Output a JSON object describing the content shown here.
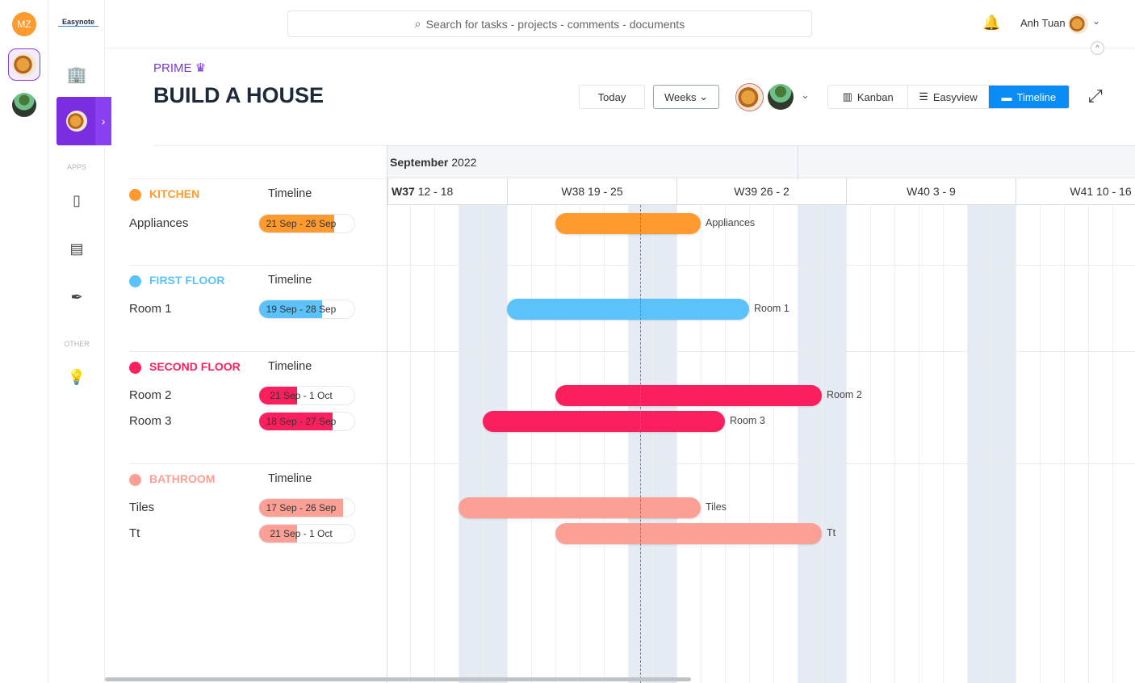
{
  "rail": {
    "user_initials": "MZ",
    "user_color": "#ff9a2e"
  },
  "sidebar": {
    "logo": "Easynote",
    "apps_label": "APPS",
    "other_label": "OTHER",
    "icons": [
      "building-icon",
      "book-icon",
      "document-icon",
      "pen-icon",
      "lightbulb-icon"
    ]
  },
  "search": {
    "placeholder": "Search for tasks - projects - comments - documents"
  },
  "user": {
    "name": "Anh Tuan"
  },
  "project": {
    "tier": "PRIME",
    "title": "BUILD A HOUSE"
  },
  "toolbar": {
    "today": "Today",
    "range": "Weeks",
    "views": [
      {
        "label": "Kanban",
        "active": false
      },
      {
        "label": "Easyview",
        "active": false
      },
      {
        "label": "Timeline",
        "active": true
      }
    ],
    "accent": "#0a8cf5"
  },
  "timeline": {
    "month": "September",
    "year": "2022",
    "weeks": [
      {
        "w": "W37",
        "days": "12 - 18"
      },
      {
        "w": "W38",
        "days": "19 - 25"
      },
      {
        "w": "W39",
        "days": "26 - 2"
      },
      {
        "w": "W40",
        "days": "3 - 9"
      },
      {
        "w": "W41",
        "days": "10 - 16"
      }
    ],
    "today": "2022-09-24",
    "groups": [
      {
        "name": "KITCHEN",
        "column": "Timeline",
        "color": "#ff9a2e",
        "tasks": [
          {
            "name": "Appliances",
            "range": "21 Sep - 26 Sep",
            "start": "2022-09-21",
            "end": "2022-09-26",
            "progress": 0.79
          }
        ]
      },
      {
        "name": "FIRST FLOOR",
        "column": "Timeline",
        "color": "#5bc2fb",
        "tasks": [
          {
            "name": "Room 1",
            "range": "19 Sep - 28 Sep",
            "start": "2022-09-19",
            "end": "2022-09-28",
            "progress": 0.66
          }
        ]
      },
      {
        "name": "SECOND FLOOR",
        "column": "Timeline",
        "color": "#fc1f5e",
        "tasks": [
          {
            "name": "Room 2",
            "range": "21 Sep - 1 Oct",
            "start": "2022-09-21",
            "end": "2022-10-01",
            "progress": 0.4
          },
          {
            "name": "Room 3",
            "range": "18 Sep - 27 Sep",
            "start": "2022-09-18",
            "end": "2022-09-27",
            "progress": 0.77
          }
        ]
      },
      {
        "name": "BATHROOM",
        "column": "Timeline",
        "color": "#fca095",
        "tasks": [
          {
            "name": "Tiles",
            "range": "17 Sep - 26 Sep",
            "start": "2022-09-17",
            "end": "2022-09-26",
            "progress": 0.88
          },
          {
            "name": "Tt",
            "range": "21 Sep - 1 Oct",
            "start": "2022-09-21",
            "end": "2022-10-01",
            "progress": 0.4
          }
        ]
      }
    ]
  }
}
